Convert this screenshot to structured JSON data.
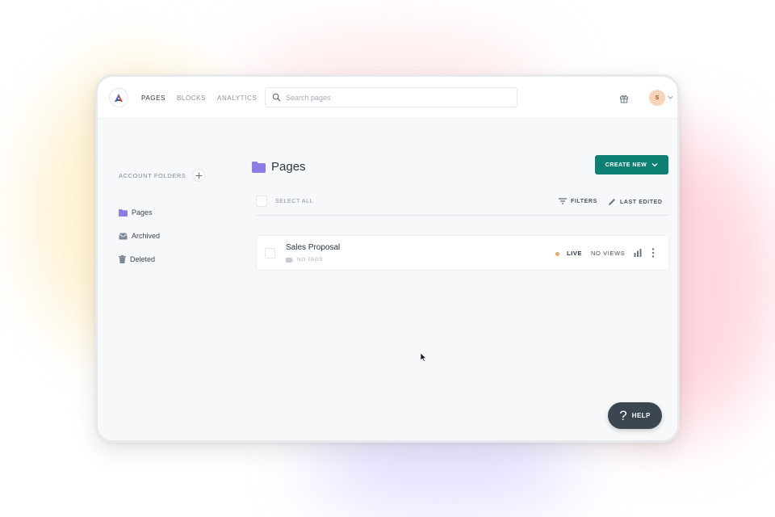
{
  "nav": {
    "items": [
      {
        "label": "PAGES",
        "active": true
      },
      {
        "label": "BLOCKS",
        "active": false
      },
      {
        "label": "ANALYTICS",
        "active": false
      }
    ]
  },
  "search": {
    "placeholder": "Search pages",
    "value": ""
  },
  "user": {
    "initial": "S"
  },
  "sidebar": {
    "section_label": "ACCOUNT FOLDERS",
    "items": [
      {
        "label": "Pages",
        "icon": "folder-icon"
      },
      {
        "label": "Archived",
        "icon": "archive-icon"
      },
      {
        "label": "Deleted",
        "icon": "trash-icon"
      }
    ]
  },
  "main": {
    "title": "Pages",
    "create_label": "CREATE NEW",
    "select_all_label": "SELECT ALL",
    "filters_label": "FILTERS",
    "sort_label": "LAST EDITED"
  },
  "rows": [
    {
      "name": "Sales Proposal",
      "tags": "NO TAGS",
      "status": "LIVE",
      "views": "NO VIEWS"
    }
  ],
  "help": {
    "label": "HELP",
    "glyph": "?"
  },
  "colors": {
    "accent": "#0d8073",
    "folder": "#8d7be6",
    "live_dot": "#f0a860",
    "help_bg": "#3b4650"
  }
}
